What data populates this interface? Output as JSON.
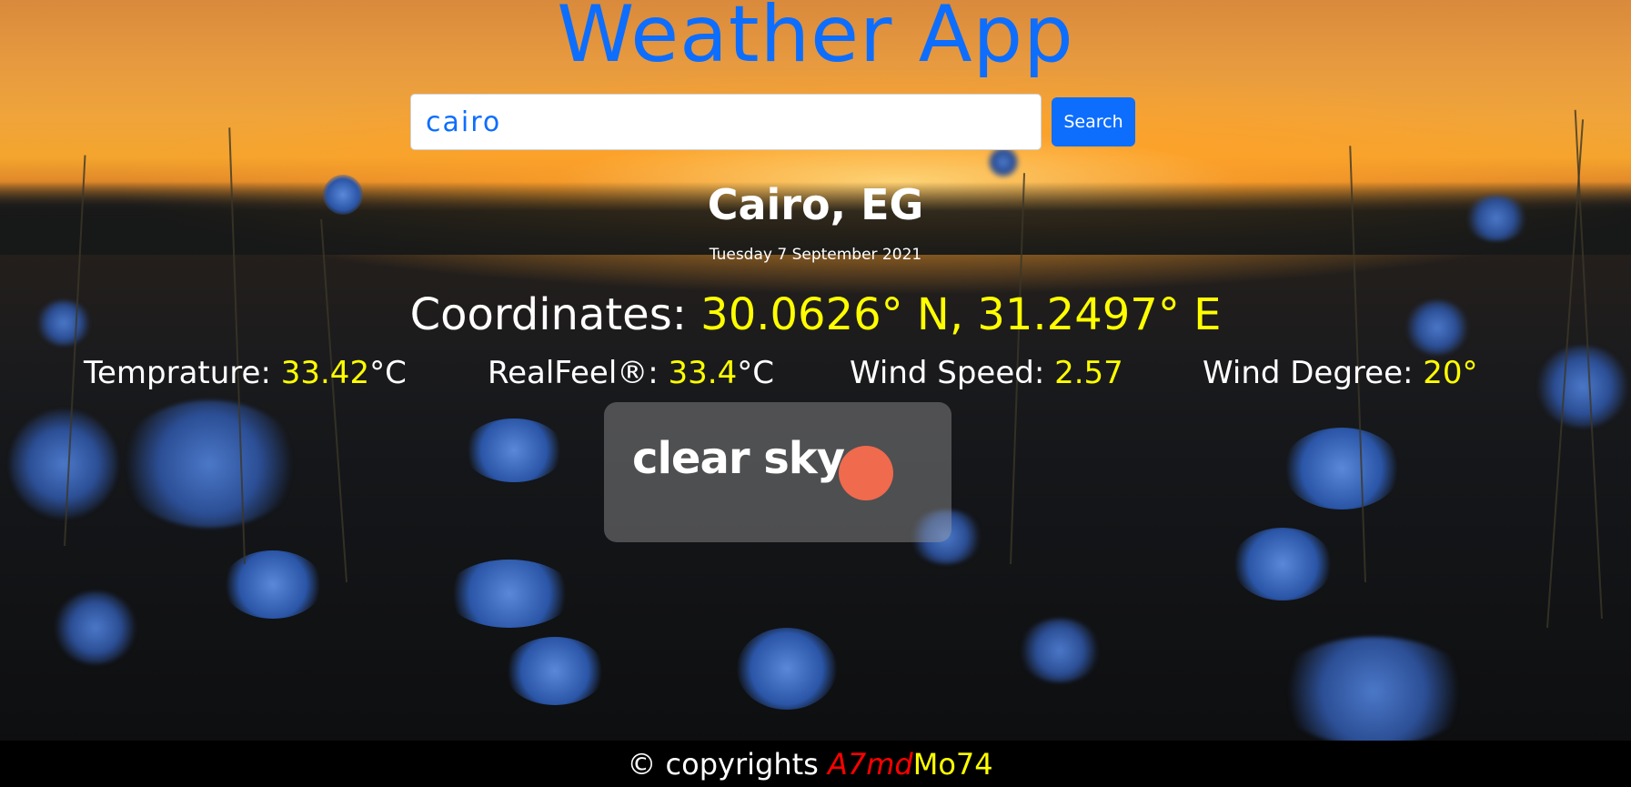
{
  "header": {
    "title": "Weather App"
  },
  "search": {
    "value": "cairo",
    "button_label": "Search"
  },
  "weather": {
    "city": "Cairo, EG",
    "date": "Tuesday 7 September 2021",
    "coordinates_label": "Coordinates:",
    "coordinates_value": "30.0626° N, 31.2497° E",
    "temperature_label": "Temprature:",
    "temperature_value": "33.42",
    "temperature_unit": "°C",
    "realfeel_label": "RealFeel®:",
    "realfeel_value": "33.4",
    "realfeel_unit": "°C",
    "wind_speed_label": "Wind Speed:",
    "wind_speed_value": "2.57",
    "wind_degree_label": "Wind Degree:",
    "wind_degree_value": "20°",
    "condition": "clear sky",
    "condition_icon": "sun-icon"
  },
  "footer": {
    "prefix": "© copyrights",
    "author_part1": "A7md",
    "author_part2": "Mo74"
  },
  "colors": {
    "accent": "#0d6efd",
    "highlight": "#ffff00",
    "author_red": "#ff0000",
    "sun": "#f06a4e"
  }
}
